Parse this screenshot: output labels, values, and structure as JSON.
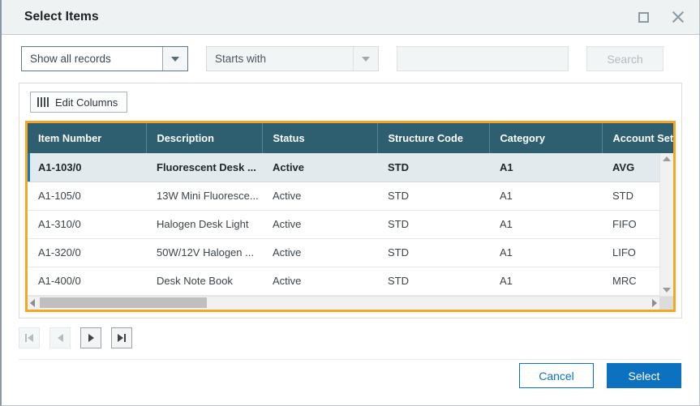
{
  "window": {
    "title": "Select Items",
    "maximize_icon": "maximize-icon",
    "close_icon": "close-icon"
  },
  "filters": {
    "records_filter": {
      "value": "Show all records",
      "icon": "chevron-down-icon"
    },
    "match_filter": {
      "value": "Starts with",
      "icon": "chevron-down-icon"
    },
    "search_input": {
      "value": "",
      "placeholder": ""
    },
    "search_button": "Search"
  },
  "toolbar": {
    "edit_columns_label": "Edit Columns",
    "edit_columns_icon": "columns-icon"
  },
  "table": {
    "columns": [
      "Item Number",
      "Description",
      "Status",
      "Structure Code",
      "Category",
      "Account Set Co"
    ],
    "rows": [
      {
        "item_number": "A1-103/0",
        "description": "Fluorescent Desk ...",
        "status": "Active",
        "structure_code": "STD",
        "category": "A1",
        "account_set_code": "AVG",
        "selected": true
      },
      {
        "item_number": "A1-105/0",
        "description": "13W Mini Fluoresce...",
        "status": "Active",
        "structure_code": "STD",
        "category": "A1",
        "account_set_code": "STD",
        "selected": false
      },
      {
        "item_number": "A1-310/0",
        "description": "Halogen Desk Light",
        "status": "Active",
        "structure_code": "STD",
        "category": "A1",
        "account_set_code": "FIFO",
        "selected": false
      },
      {
        "item_number": "A1-320/0",
        "description": "50W/12V Halogen ...",
        "status": "Active",
        "structure_code": "STD",
        "category": "A1",
        "account_set_code": "LIFO",
        "selected": false
      },
      {
        "item_number": "A1-400/0",
        "description": "Desk Note Book",
        "status": "Active",
        "structure_code": "STD",
        "category": "A1",
        "account_set_code": "MRC",
        "selected": false
      }
    ]
  },
  "pager": {
    "first_icon": "first-page-icon",
    "previous_icon": "previous-page-icon",
    "next_icon": "next-page-icon",
    "last_icon": "last-page-icon"
  },
  "footer": {
    "cancel_label": "Cancel",
    "select_label": "Select"
  },
  "colors": {
    "accent_blue": "#0c72c0",
    "header_teal": "#2e5f70",
    "focus_orange": "#f5a623",
    "selected_row": "#e3eaee"
  }
}
